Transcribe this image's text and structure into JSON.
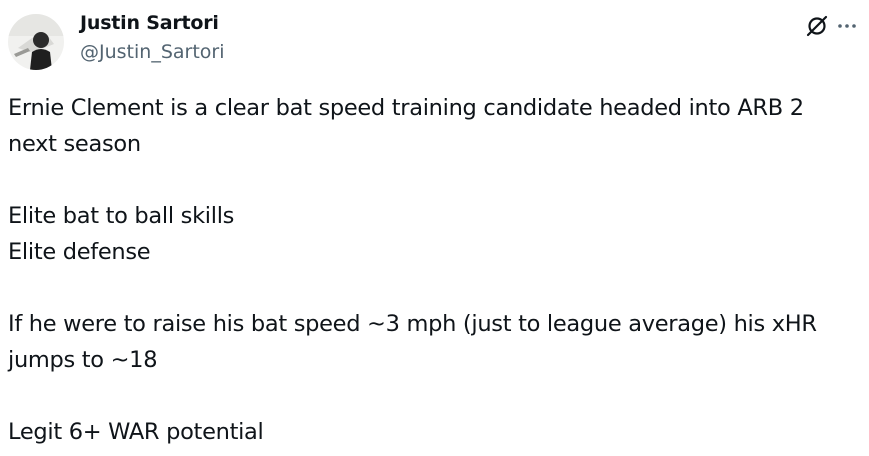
{
  "author": {
    "display_name": "Justin Sartori",
    "handle": "@Justin_Sartori"
  },
  "header_actions": {
    "grok_icon": "grok-slash-circle-icon",
    "more_icon": "more-horizontal-icon"
  },
  "tweet": {
    "paragraphs": [
      [
        "Ernie Clement is a clear bat speed training candidate headed into ARB 2",
        "next season"
      ],
      [
        "Elite bat to ball skills",
        "Elite defense"
      ],
      [
        "If he were to raise his bat speed ~3 mph (just to league average) his xHR",
        "jumps to ~18"
      ],
      [
        "Legit 6+ WAR potential"
      ]
    ]
  },
  "colors": {
    "text_primary": "#0f1419",
    "text_secondary": "#536471",
    "background": "#ffffff"
  }
}
